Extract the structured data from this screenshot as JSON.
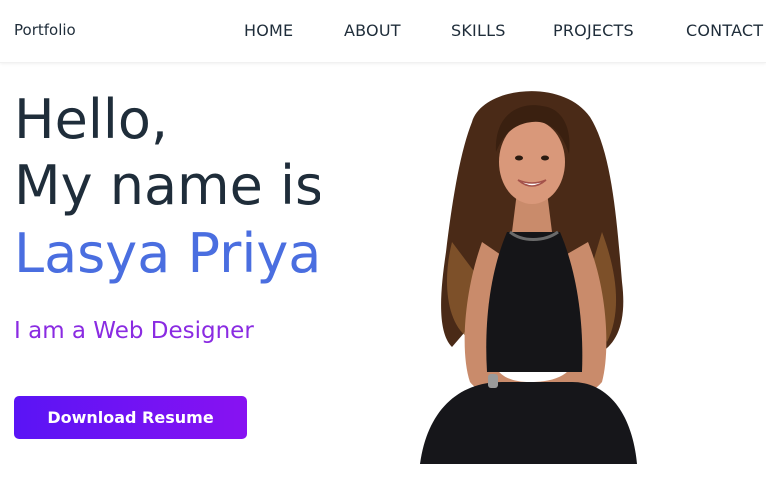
{
  "nav": {
    "brand": "Portfolio",
    "links": [
      "HOME",
      "ABOUT",
      "SKILLS",
      "PROJECTS",
      "CONTACT"
    ]
  },
  "hero": {
    "greeting": "Hello,",
    "intro": "My name is",
    "name": "Lasya Priya",
    "role": "I am a Web Designer",
    "button_label": "Download Resume"
  },
  "colors": {
    "heading": "#1f2d3a",
    "name_accent": "#4a6ee0",
    "role": "#8a2be2",
    "button_gradient_start": "#5a14f5",
    "button_gradient_end": "#8812f2"
  }
}
